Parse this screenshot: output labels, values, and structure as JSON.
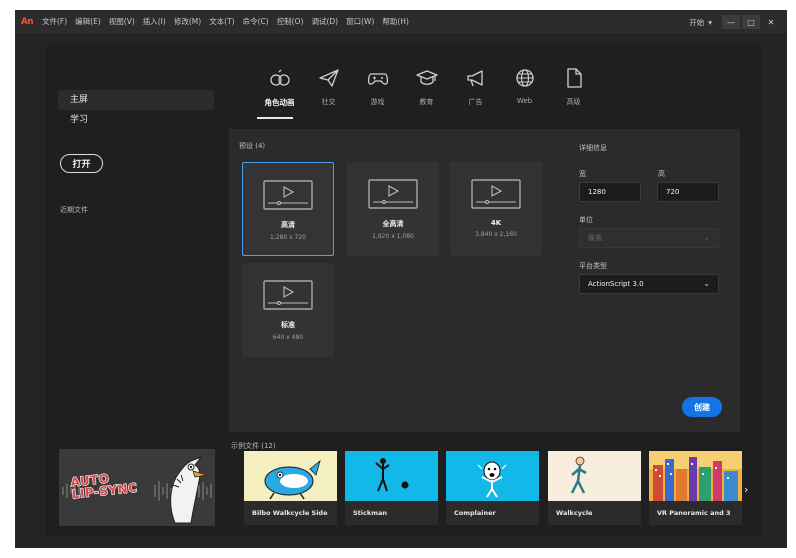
{
  "menubar": {
    "logo": "An",
    "items": [
      "文件(F)",
      "编辑(E)",
      "视图(V)",
      "插入(I)",
      "修改(M)",
      "文本(T)",
      "命令(C)",
      "控制(O)",
      "调试(D)",
      "窗口(W)",
      "帮助(H)"
    ],
    "workspace": "开始",
    "workspace_caret": "▾",
    "minimize": "—",
    "maximize": "□",
    "close": "✕"
  },
  "sidebar": {
    "items": [
      {
        "label": "主屏",
        "active": true
      },
      {
        "label": "学习",
        "active": false
      }
    ],
    "open_button": "打开",
    "recent_label": "近期文件",
    "promo_text_line1": "AUTO",
    "promo_text_line2": "LIP-SYNC"
  },
  "categories": [
    {
      "label": "角色动画",
      "icon": "character-animation-icon",
      "active": true
    },
    {
      "label": "社交",
      "icon": "paper-plane-icon",
      "active": false
    },
    {
      "label": "游戏",
      "icon": "gamepad-icon",
      "active": false
    },
    {
      "label": "教育",
      "icon": "graduation-cap-icon",
      "active": false
    },
    {
      "label": "广告",
      "icon": "megaphone-icon",
      "active": false
    },
    {
      "label": "Web",
      "icon": "globe-icon",
      "active": false
    },
    {
      "label": "高级",
      "icon": "document-icon",
      "active": false
    }
  ],
  "presets": {
    "label": "预设 (4)",
    "items": [
      {
        "name": "高清",
        "size": "1,280 x 720",
        "selected": true
      },
      {
        "name": "全高清",
        "size": "1,920 x 1,080",
        "selected": false
      },
      {
        "name": "4K",
        "size": "3,840 x 2,160",
        "selected": false
      },
      {
        "name": "标准",
        "size": "640 x 480",
        "selected": false
      }
    ]
  },
  "details": {
    "title": "详细信息",
    "width_label": "宽",
    "height_label": "高",
    "width_value": "1280",
    "height_value": "720",
    "unit_label": "单位",
    "unit_value": "像素",
    "platform_label": "平台类型",
    "platform_value": "ActionScript 3.0",
    "create_button": "创建"
  },
  "samples": {
    "label": "示例文件 (12)",
    "items": [
      {
        "title": "Bilbo Walkcycle Side"
      },
      {
        "title": "Stickman"
      },
      {
        "title": "Complainer"
      },
      {
        "title": "Walkcycle"
      },
      {
        "title": "VR Panoramic and 3"
      }
    ],
    "next": "›"
  },
  "colors": {
    "accent": "#1473e6",
    "selected_border": "#4a9ef0",
    "logo": "#ff4b33"
  }
}
